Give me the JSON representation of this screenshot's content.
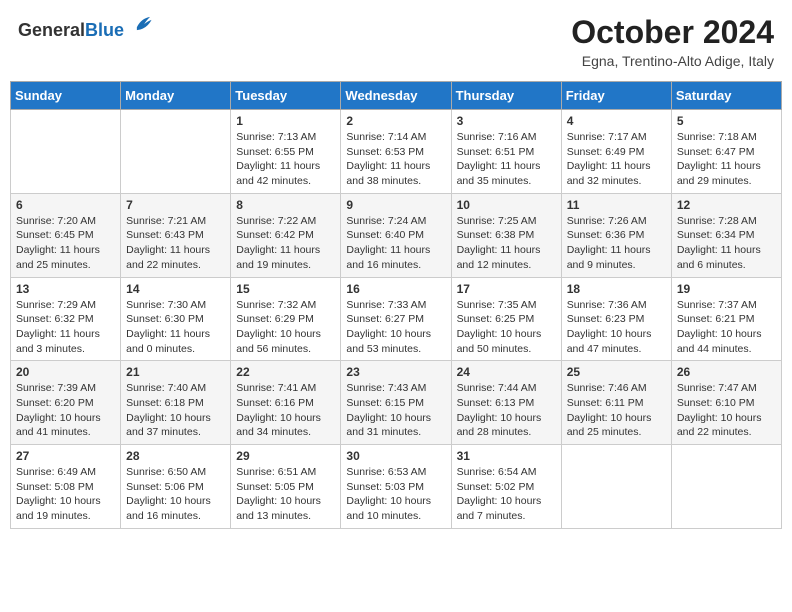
{
  "header": {
    "logo_general": "General",
    "logo_blue": "Blue",
    "month": "October 2024",
    "location": "Egna, Trentino-Alto Adige, Italy"
  },
  "weekdays": [
    "Sunday",
    "Monday",
    "Tuesday",
    "Wednesday",
    "Thursday",
    "Friday",
    "Saturday"
  ],
  "weeks": [
    [
      {
        "day": "",
        "sunrise": "",
        "sunset": "",
        "daylight": ""
      },
      {
        "day": "",
        "sunrise": "",
        "sunset": "",
        "daylight": ""
      },
      {
        "day": "1",
        "sunrise": "Sunrise: 7:13 AM",
        "sunset": "Sunset: 6:55 PM",
        "daylight": "Daylight: 11 hours and 42 minutes."
      },
      {
        "day": "2",
        "sunrise": "Sunrise: 7:14 AM",
        "sunset": "Sunset: 6:53 PM",
        "daylight": "Daylight: 11 hours and 38 minutes."
      },
      {
        "day": "3",
        "sunrise": "Sunrise: 7:16 AM",
        "sunset": "Sunset: 6:51 PM",
        "daylight": "Daylight: 11 hours and 35 minutes."
      },
      {
        "day": "4",
        "sunrise": "Sunrise: 7:17 AM",
        "sunset": "Sunset: 6:49 PM",
        "daylight": "Daylight: 11 hours and 32 minutes."
      },
      {
        "day": "5",
        "sunrise": "Sunrise: 7:18 AM",
        "sunset": "Sunset: 6:47 PM",
        "daylight": "Daylight: 11 hours and 29 minutes."
      }
    ],
    [
      {
        "day": "6",
        "sunrise": "Sunrise: 7:20 AM",
        "sunset": "Sunset: 6:45 PM",
        "daylight": "Daylight: 11 hours and 25 minutes."
      },
      {
        "day": "7",
        "sunrise": "Sunrise: 7:21 AM",
        "sunset": "Sunset: 6:43 PM",
        "daylight": "Daylight: 11 hours and 22 minutes."
      },
      {
        "day": "8",
        "sunrise": "Sunrise: 7:22 AM",
        "sunset": "Sunset: 6:42 PM",
        "daylight": "Daylight: 11 hours and 19 minutes."
      },
      {
        "day": "9",
        "sunrise": "Sunrise: 7:24 AM",
        "sunset": "Sunset: 6:40 PM",
        "daylight": "Daylight: 11 hours and 16 minutes."
      },
      {
        "day": "10",
        "sunrise": "Sunrise: 7:25 AM",
        "sunset": "Sunset: 6:38 PM",
        "daylight": "Daylight: 11 hours and 12 minutes."
      },
      {
        "day": "11",
        "sunrise": "Sunrise: 7:26 AM",
        "sunset": "Sunset: 6:36 PM",
        "daylight": "Daylight: 11 hours and 9 minutes."
      },
      {
        "day": "12",
        "sunrise": "Sunrise: 7:28 AM",
        "sunset": "Sunset: 6:34 PM",
        "daylight": "Daylight: 11 hours and 6 minutes."
      }
    ],
    [
      {
        "day": "13",
        "sunrise": "Sunrise: 7:29 AM",
        "sunset": "Sunset: 6:32 PM",
        "daylight": "Daylight: 11 hours and 3 minutes."
      },
      {
        "day": "14",
        "sunrise": "Sunrise: 7:30 AM",
        "sunset": "Sunset: 6:30 PM",
        "daylight": "Daylight: 11 hours and 0 minutes."
      },
      {
        "day": "15",
        "sunrise": "Sunrise: 7:32 AM",
        "sunset": "Sunset: 6:29 PM",
        "daylight": "Daylight: 10 hours and 56 minutes."
      },
      {
        "day": "16",
        "sunrise": "Sunrise: 7:33 AM",
        "sunset": "Sunset: 6:27 PM",
        "daylight": "Daylight: 10 hours and 53 minutes."
      },
      {
        "day": "17",
        "sunrise": "Sunrise: 7:35 AM",
        "sunset": "Sunset: 6:25 PM",
        "daylight": "Daylight: 10 hours and 50 minutes."
      },
      {
        "day": "18",
        "sunrise": "Sunrise: 7:36 AM",
        "sunset": "Sunset: 6:23 PM",
        "daylight": "Daylight: 10 hours and 47 minutes."
      },
      {
        "day": "19",
        "sunrise": "Sunrise: 7:37 AM",
        "sunset": "Sunset: 6:21 PM",
        "daylight": "Daylight: 10 hours and 44 minutes."
      }
    ],
    [
      {
        "day": "20",
        "sunrise": "Sunrise: 7:39 AM",
        "sunset": "Sunset: 6:20 PM",
        "daylight": "Daylight: 10 hours and 41 minutes."
      },
      {
        "day": "21",
        "sunrise": "Sunrise: 7:40 AM",
        "sunset": "Sunset: 6:18 PM",
        "daylight": "Daylight: 10 hours and 37 minutes."
      },
      {
        "day": "22",
        "sunrise": "Sunrise: 7:41 AM",
        "sunset": "Sunset: 6:16 PM",
        "daylight": "Daylight: 10 hours and 34 minutes."
      },
      {
        "day": "23",
        "sunrise": "Sunrise: 7:43 AM",
        "sunset": "Sunset: 6:15 PM",
        "daylight": "Daylight: 10 hours and 31 minutes."
      },
      {
        "day": "24",
        "sunrise": "Sunrise: 7:44 AM",
        "sunset": "Sunset: 6:13 PM",
        "daylight": "Daylight: 10 hours and 28 minutes."
      },
      {
        "day": "25",
        "sunrise": "Sunrise: 7:46 AM",
        "sunset": "Sunset: 6:11 PM",
        "daylight": "Daylight: 10 hours and 25 minutes."
      },
      {
        "day": "26",
        "sunrise": "Sunrise: 7:47 AM",
        "sunset": "Sunset: 6:10 PM",
        "daylight": "Daylight: 10 hours and 22 minutes."
      }
    ],
    [
      {
        "day": "27",
        "sunrise": "Sunrise: 6:49 AM",
        "sunset": "Sunset: 5:08 PM",
        "daylight": "Daylight: 10 hours and 19 minutes."
      },
      {
        "day": "28",
        "sunrise": "Sunrise: 6:50 AM",
        "sunset": "Sunset: 5:06 PM",
        "daylight": "Daylight: 10 hours and 16 minutes."
      },
      {
        "day": "29",
        "sunrise": "Sunrise: 6:51 AM",
        "sunset": "Sunset: 5:05 PM",
        "daylight": "Daylight: 10 hours and 13 minutes."
      },
      {
        "day": "30",
        "sunrise": "Sunrise: 6:53 AM",
        "sunset": "Sunset: 5:03 PM",
        "daylight": "Daylight: 10 hours and 10 minutes."
      },
      {
        "day": "31",
        "sunrise": "Sunrise: 6:54 AM",
        "sunset": "Sunset: 5:02 PM",
        "daylight": "Daylight: 10 hours and 7 minutes."
      },
      {
        "day": "",
        "sunrise": "",
        "sunset": "",
        "daylight": ""
      },
      {
        "day": "",
        "sunrise": "",
        "sunset": "",
        "daylight": ""
      }
    ]
  ]
}
